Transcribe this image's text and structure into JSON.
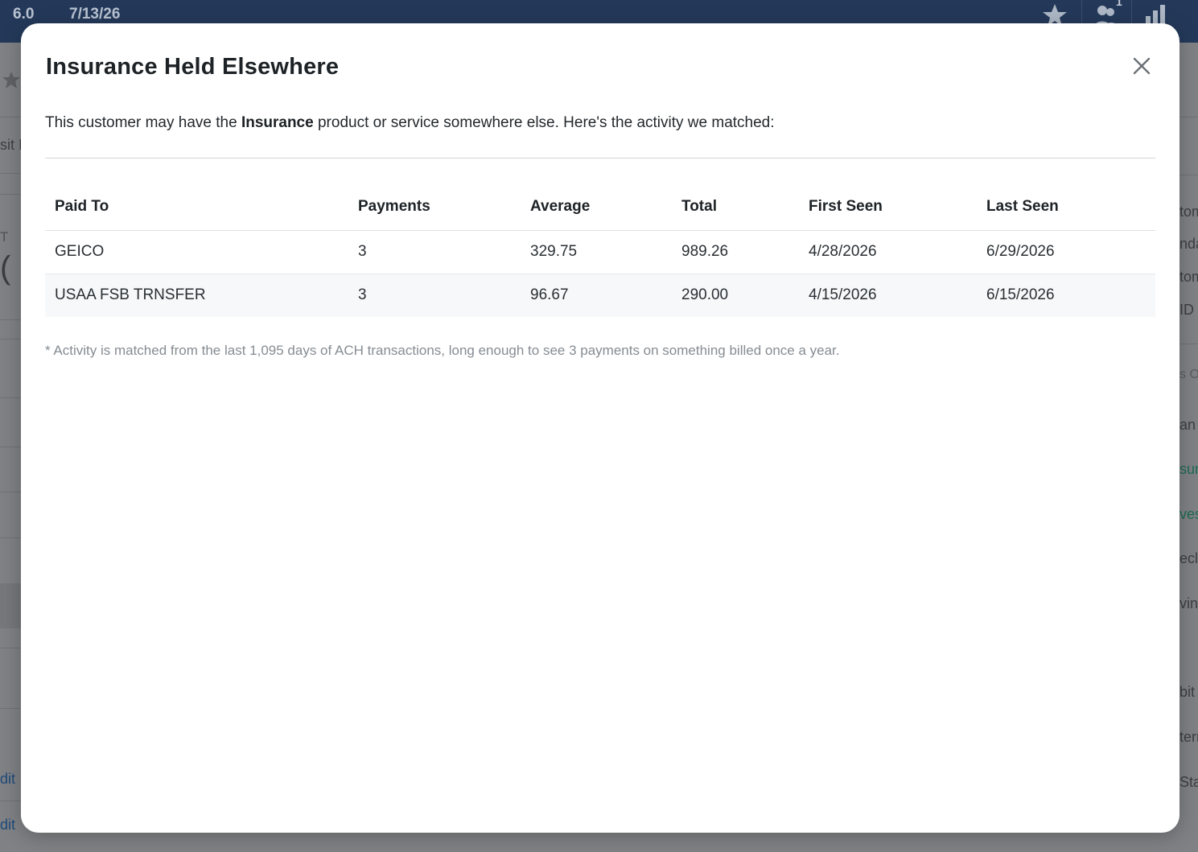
{
  "topbar": {
    "version": "6.0",
    "date": "7/13/26",
    "icons": [
      "star-icon",
      "users-icon",
      "bar-chart-icon"
    ],
    "badge": "1"
  },
  "background": {
    "left_fragments": [
      "sit I",
      "T",
      "(",
      "dit",
      "dit"
    ],
    "right_fragments": [
      "tom",
      "nda",
      "tom",
      "ID",
      "s O",
      "an",
      "sura",
      "ves",
      "ecl",
      "vin",
      "bit",
      "terr",
      "Stat"
    ]
  },
  "modal": {
    "title": "Insurance Held Elsewhere",
    "close_icon": "close-icon",
    "intro_before": "This customer may have the ",
    "intro_bold": "Insurance",
    "intro_after": " product or service somewhere else. Here's the activity we matched:",
    "table": {
      "headers": [
        "Paid To",
        "Payments",
        "Average",
        "Total",
        "First Seen",
        "Last Seen"
      ],
      "rows": [
        [
          "GEICO",
          "3",
          "329.75",
          "989.26",
          "4/28/2026",
          "6/29/2026"
        ],
        [
          "USAA FSB TRNSFER",
          "3",
          "96.67",
          "290.00",
          "4/15/2026",
          "6/15/2026"
        ]
      ]
    },
    "footnote": "* Activity is matched from the last 1,095 days of ACH transactions, long enough to see 3 payments on something billed once a year."
  },
  "colors": {
    "topbar": "#24395a",
    "overlay": "#7f8184",
    "accent_link": "#1f4a7a",
    "accent_green": "#1e6b52"
  }
}
